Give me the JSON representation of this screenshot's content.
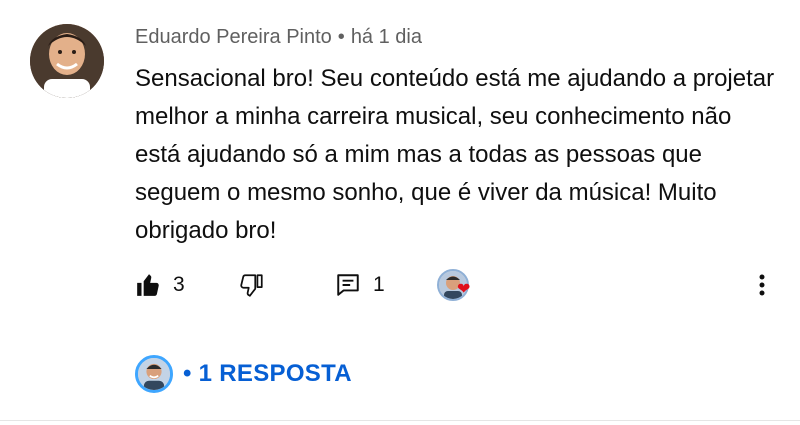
{
  "comment": {
    "author": "Eduardo Pereira Pinto",
    "separator": "•",
    "time": "há 1 dia",
    "text": "Sensacional bro! Seu conteúdo está me ajudando a projetar melhor a minha carreira musical, seu conhecimento não está ajudando só a mim mas a todas as pessoas que seguem o mesmo sonho, que é viver da música! Muito obrigado bro!"
  },
  "actions": {
    "like_count": "3",
    "reply_count": "1",
    "like_icon": "thumbs-up-icon",
    "dislike_icon": "thumbs-down-icon",
    "reply_icon": "comment-icon",
    "more_icon": "more-vertical-icon"
  },
  "replies": {
    "label": "• 1 RESPOSTA"
  },
  "colors": {
    "link": "#065fd4",
    "meta": "#606060",
    "heart": "#e0101c",
    "accent_ring": "#3ea6ff"
  }
}
